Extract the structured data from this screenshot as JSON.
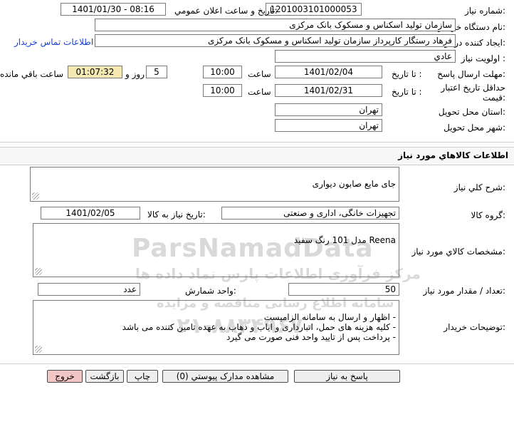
{
  "need_number": {
    "label": "شماره نياز:",
    "value": "1201003101000053"
  },
  "announce_datetime": {
    "label": "تاريخ و ساعت اعلان عمومي:",
    "value": "1401/01/30 - 08:16"
  },
  "buyer_org": {
    "label": "نام دستگاه خريدار:",
    "value": "سازمان تولید اسکناس و مسکوک بانک مرکزی"
  },
  "requester": {
    "label": "ايجاد کننده درخواست:",
    "value": "فرهاد رستگار کارپرداز سازمان تولید اسکناس و مسکوک بانک مرکزی",
    "contact_link": "اطلاعات تماس خريدار"
  },
  "priority": {
    "label": "اولويت نياز :",
    "value": "عادي"
  },
  "reply_deadline": {
    "label": "مهلت ارسال پاسخ:",
    "until_label": "تا تاريخ :",
    "date": "1401/02/04",
    "time_label": "ساعت",
    "time": "10:00",
    "days": "5",
    "days_label": "روز و",
    "remaining": "01:07:32",
    "remaining_label": "ساعت باقي مانده"
  },
  "price_validity": {
    "label": "حداقل تاريخ اعتبار قيمت:",
    "until_label": "تا تاريخ :",
    "date": "1401/02/31",
    "time_label": "ساعت",
    "time": "10:00"
  },
  "delivery_province": {
    "label": "استان محل تحويل:",
    "value": "تهران"
  },
  "delivery_city": {
    "label": "شهر محل تحويل:",
    "value": "تهران"
  },
  "goods_section": {
    "title": "اطلاعات کالاهاي مورد نياز"
  },
  "general_desc": {
    "label": "شرح کلي نياز:",
    "value": "جای مایع صابون دیواری"
  },
  "goods_group": {
    "label": "گروه کالا:",
    "value": "تجهیزات خانگی، اداری و صنعتی",
    "need_date_label": "تاريخ نياز به کالا:",
    "need_date": "1401/02/05"
  },
  "specs": {
    "label": "مشخصات کالاي مورد نياز:",
    "value": "Reena مدل 101 رنگ سفید"
  },
  "quantity": {
    "label": "تعداد / مقدار مورد نياز:",
    "value": "50",
    "unit_label": "واحد شمارش:",
    "unit": "عدد"
  },
  "buyer_notes": {
    "label": "توضيحات خريدار:",
    "value": "- اظهار و ارسال به سامانه الزامیست\n- کلیه هزینه های حمل، انبارداری و ایاب و ذهاب به عهده تامین کننده می باشد\n- پرداخت پس از تایید واحد فنی صورت می گیرد"
  },
  "buttons": {
    "reply": "پاسخ به نياز",
    "attachments": "مشاهده مدارک پيوستي (0)",
    "print": "چاپ",
    "back": "بازگشت",
    "exit": "خروج"
  },
  "watermark": {
    "brand": "ParsNamadData",
    "tagline": "مرکز فرآوری اطلاعات پارس نماد داده ها",
    "line2": "سامانه اطلاع رسانی مناقصه و مزایده",
    "phone": "۰۲۱-۸۸۳۴۹۶۷۰"
  },
  "colors": {
    "remaining_bg": "#f5e9b3",
    "exit_bg": "#f3c6c6",
    "link": "#1a3ecf",
    "border": "#7a7a7a"
  }
}
